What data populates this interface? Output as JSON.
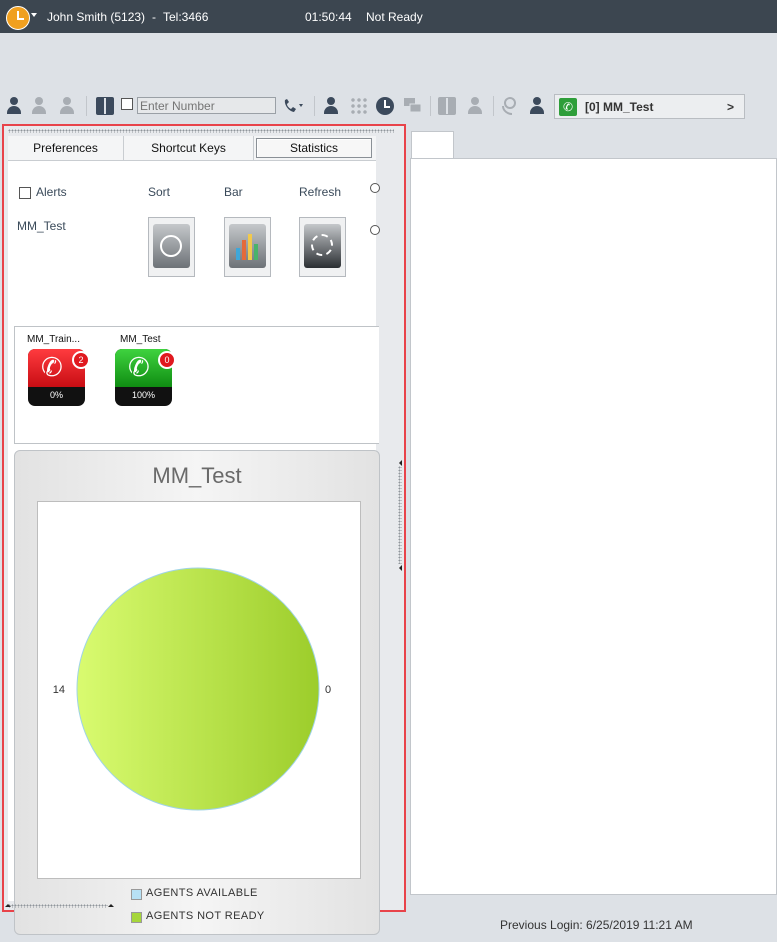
{
  "titlebar": {
    "user": "John Smith (5123)",
    "separator": "-",
    "tel": "Tel:3466",
    "time": "01:50:44",
    "status": "Not Ready"
  },
  "toolbar": {
    "number_placeholder": "Enter Number",
    "queue_label": "[0] MM_Test",
    "queue_arrow": ">"
  },
  "tabs": [
    {
      "label": "Preferences"
    },
    {
      "label": "Shortcut Keys"
    },
    {
      "label": "Statistics",
      "active": true
    }
  ],
  "statistics": {
    "alerts_label": "Alerts",
    "sort_label": "Sort",
    "bar_label": "Bar",
    "refresh_label": "Refresh",
    "queue_name": "MM_Test",
    "queues": [
      {
        "name": "MM_Train...",
        "badge": "2",
        "percent": "0%",
        "color": "#e8141b"
      },
      {
        "name": "MM_Test",
        "badge": "0",
        "percent": "100%",
        "color": "#19a51c"
      }
    ]
  },
  "chart_data": {
    "type": "pie",
    "title": "MM_Test",
    "slices": [
      {
        "label": "AGENTS AVAILABLE",
        "value": 0,
        "color": "#b7e1f5"
      },
      {
        "label": "AGENTS NOT READY",
        "value": 14,
        "color": "#a6d63a"
      }
    ],
    "data_labels": [
      "14",
      "0"
    ],
    "legend": [
      "AGENTS AVAILABLE",
      "AGENTS NOT READY"
    ],
    "legend_position": "bottom"
  },
  "footer": {
    "previous_login": "Previous Login: 6/25/2019 11:21 AM"
  }
}
